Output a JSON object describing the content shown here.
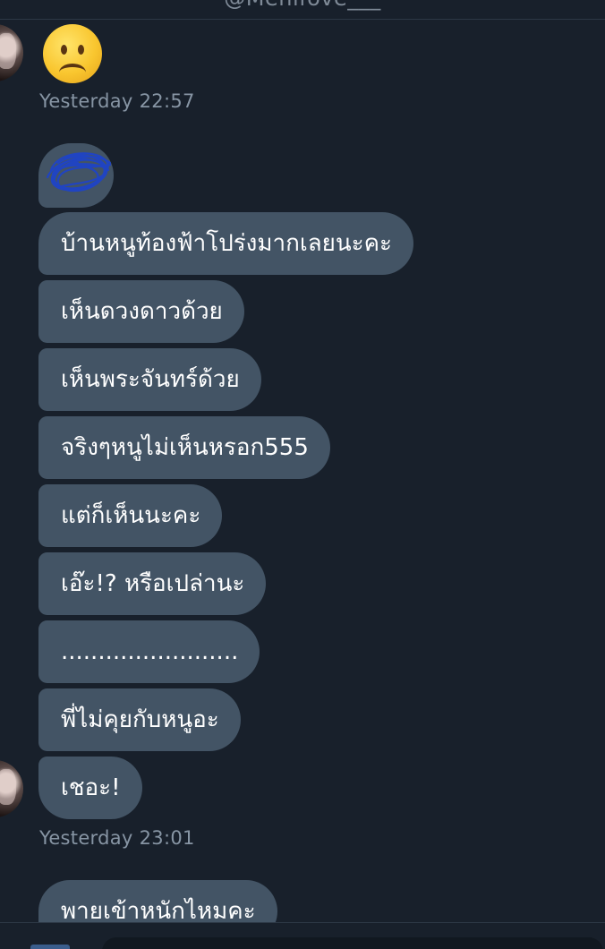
{
  "header": {
    "handle": "@Menifove___"
  },
  "messages": {
    "group1": {
      "emoji": "frowning-face-emoji",
      "timestamp": "Yesterday 22:57"
    },
    "group2": {
      "scribble": "redacted-scribble",
      "bubbles": [
        "บ้านหนูท้องฟ้าโปร่งมากเลยนะคะ",
        "เห็นดวงดาวด้วย",
        "เห็นพระจันทร์ด้วย",
        "จริงๆหนูไม่เห็นหรอก555",
        "แต่ก็เห็นนะคะ",
        "เอ๊ะ!? หรือเปล่านะ",
        "........................",
        "พี่ไม่คุยกับหนูอะ",
        "เชอะ!"
      ],
      "timestamp": "Yesterday 23:01"
    },
    "group3": {
      "bubbles": [
        "พายเข้าหนักไหมคะ"
      ]
    }
  },
  "colors": {
    "background": "#18202b",
    "bubble": "#435465",
    "timestamp": "#8795a4",
    "scribble": "#1f44c8"
  }
}
